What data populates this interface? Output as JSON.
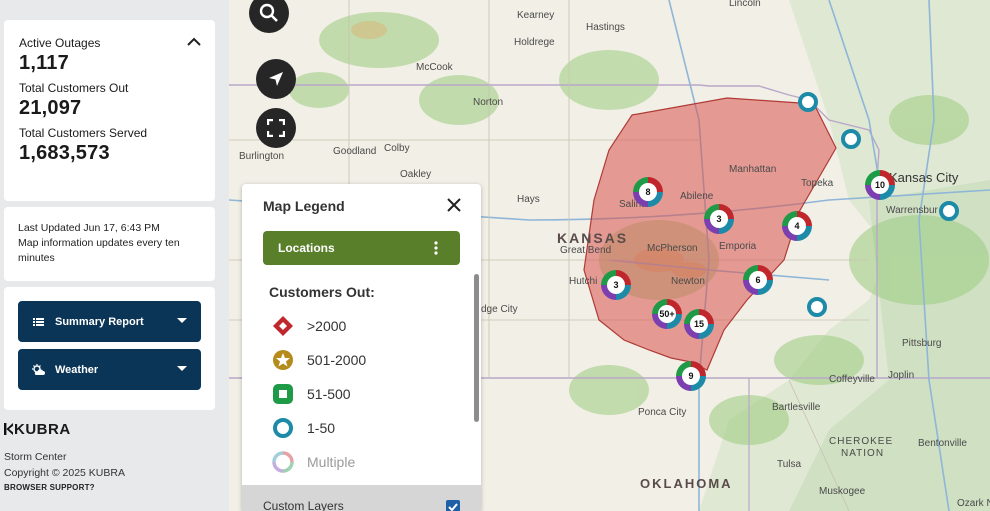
{
  "stats": {
    "active_outages_label": "Active Outages",
    "active_outages_value": "1,117",
    "customers_out_label": "Total Customers Out",
    "customers_out_value": "21,097",
    "customers_served_label": "Total Customers Served",
    "customers_served_value": "1,683,573"
  },
  "update": {
    "last_updated": "Last Updated  Jun 17, 6:43 PM",
    "note": "Map information updates every ten minutes"
  },
  "sidebar_buttons": {
    "summary_report": "Summary Report",
    "weather": "Weather"
  },
  "brand": {
    "logo": "KUBRA",
    "app_name": "Storm Center",
    "copyright": "Copyright © 2025 KUBRA",
    "browser_support": "BROWSER SUPPORT?"
  },
  "legend": {
    "title": "Map Legend",
    "locations_label": "Locations",
    "customers_out_title": "Customers Out:",
    "items": [
      {
        "label": ">2000",
        "icon": "diamond-icon",
        "color": "#c0272d"
      },
      {
        "label": "501-2000",
        "icon": "star-icon",
        "color": "#b58b1c"
      },
      {
        "label": "51-500",
        "icon": "square-icon",
        "color": "#1f9a47"
      },
      {
        "label": "1-50",
        "icon": "circle-icon",
        "color": "#1d8aa7"
      },
      {
        "label": "Multiple",
        "icon": "multiple-icon",
        "color": "#9b9b9b"
      }
    ],
    "custom_layers": "Custom Layers"
  },
  "places": {
    "kearney": "Kearney",
    "hastings": "Hastings",
    "lincoln": "Lincoln",
    "holdrege": "Holdrege",
    "mccook": "McCook",
    "norton": "Norton",
    "burlington": "Burlington",
    "goodland": "Goodland",
    "colby": "Colby",
    "oakley": "Oakley",
    "hays": "Hays",
    "salina": "Salina",
    "abilene": "Abilene",
    "manhattan": "Manhattan",
    "topeka": "Topeka",
    "kansas_city": "Kansas City",
    "warrensburg": "Warrensbur",
    "kansas": "KANSAS",
    "great_bend": "Great Bend",
    "mcpherson": "McPherson",
    "emporia": "Emporia",
    "hutchinson": "Hutchi",
    "newton": "Newton",
    "dodge_city": "dge City",
    "pittsburg": "Pittsburg",
    "coffeyville": "Coffeyville",
    "joplin": "Joplin",
    "bartlesville": "Bartlesville",
    "ponca_city": "Ponca City",
    "cherokee_nation": "CHEROKEE",
    "nation": "NATION",
    "bentonville": "Bentonville",
    "tulsa": "Tulsa",
    "oklahoma": "OKLAHOMA",
    "muskogee": "Muskogee",
    "ozark": "Ozark N"
  },
  "clusters": [
    {
      "count": "8",
      "colors": [
        "#c0272d",
        "#1f9a47",
        "#7b3fb0",
        "#1d8aa7"
      ]
    },
    {
      "count": "3",
      "colors": [
        "#c0272d",
        "#1f9a47",
        "#7b3fb0",
        "#1d8aa7"
      ]
    },
    {
      "count": "4",
      "colors": [
        "#c0272d",
        "#1f9a47",
        "#7b3fb0",
        "#1d8aa7"
      ]
    },
    {
      "count": "10",
      "colors": [
        "#c0272d",
        "#1f9a47",
        "#7b3fb0",
        "#1d8aa7"
      ]
    },
    {
      "count": "3",
      "colors": [
        "#c0272d",
        "#1f9a47",
        "#7b3fb0",
        "#1d8aa7"
      ]
    },
    {
      "count": "6",
      "colors": [
        "#c0272d",
        "#1f9a47",
        "#7b3fb0",
        "#1d8aa7"
      ]
    },
    {
      "count": "50+",
      "colors": [
        "#c0272d",
        "#1f9a47",
        "#7b3fb0",
        "#1d8aa7"
      ]
    },
    {
      "count": "15",
      "colors": [
        "#c0272d",
        "#1f9a47",
        "#7b3fb0",
        "#1d8aa7"
      ]
    },
    {
      "count": "9",
      "colors": [
        "#c0272d",
        "#1f9a47",
        "#7b3fb0",
        "#1d8aa7"
      ]
    }
  ],
  "colors": {
    "sidebar_button": "#0b3556",
    "locations_button": "#5a7f2b",
    "outage_area": "#d9534f"
  }
}
